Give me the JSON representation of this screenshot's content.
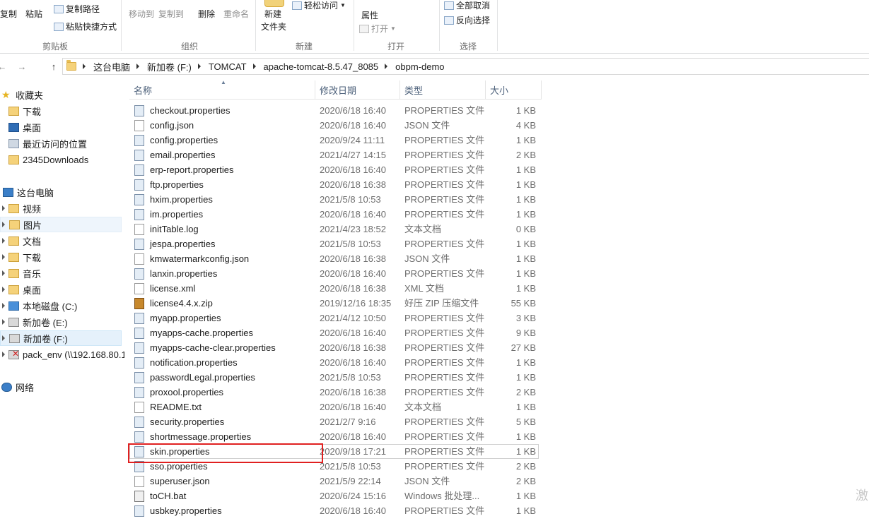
{
  "ribbon": {
    "copy": "复制",
    "paste": "粘贴",
    "copy_path": "复制路径",
    "paste_shortcut": "粘贴快捷方式",
    "clipboard": "剪贴板",
    "move_to": "移动到",
    "copy_to": "复制到",
    "delete": "删除",
    "rename": "重命名",
    "organize": "组织",
    "new_folder_1": "新建",
    "new_folder_2": "文件夹",
    "easy_access": "轻松访问",
    "new": "新建",
    "properties": "属性",
    "open": "打开",
    "open_group": "打开",
    "select_none": "全部取消",
    "invert_selection": "反向选择",
    "select": "选择"
  },
  "address": {
    "crumbs": [
      "这台电脑",
      "新加卷 (F:)",
      "TOMCAT",
      "apache-tomcat-8.5.47_8085",
      "obpm-demo"
    ]
  },
  "nav": {
    "favorites": "收藏夹",
    "downloads": "下载",
    "desktop": "桌面",
    "recent": "最近访问的位置",
    "d2345": "2345Downloads",
    "this_pc": "这台电脑",
    "videos": "视频",
    "pictures": "图片",
    "documents": "文档",
    "downloads2": "下载",
    "music": "音乐",
    "desktop2": "桌面",
    "drive_c": "本地磁盘 (C:)",
    "drive_e": "新加卷 (E:)",
    "drive_f": "新加卷 (F:)",
    "pack_env": "pack_env (\\\\192.168.80.1",
    "network": "网络"
  },
  "columns": {
    "name": "名称",
    "date": "修改日期",
    "type": "类型",
    "size": "大小"
  },
  "files": [
    {
      "name": "checkout.properties",
      "date": "2020/6/18 16:40",
      "type": "PROPERTIES 文件",
      "size": "1 KB",
      "icon": "properties-file-icon"
    },
    {
      "name": "config.json",
      "date": "2020/6/18 16:40",
      "type": "JSON 文件",
      "size": "4 KB",
      "icon": "document-icon"
    },
    {
      "name": "config.properties",
      "date": "2020/9/24 11:11",
      "type": "PROPERTIES 文件",
      "size": "1 KB",
      "icon": "properties-file-icon"
    },
    {
      "name": "email.properties",
      "date": "2021/4/27 14:15",
      "type": "PROPERTIES 文件",
      "size": "2 KB",
      "icon": "properties-file-icon"
    },
    {
      "name": "erp-report.properties",
      "date": "2020/6/18 16:40",
      "type": "PROPERTIES 文件",
      "size": "1 KB",
      "icon": "properties-file-icon"
    },
    {
      "name": "ftp.properties",
      "date": "2020/6/18 16:38",
      "type": "PROPERTIES 文件",
      "size": "1 KB",
      "icon": "properties-file-icon"
    },
    {
      "name": "hxim.properties",
      "date": "2021/5/8 10:53",
      "type": "PROPERTIES 文件",
      "size": "1 KB",
      "icon": "properties-file-icon"
    },
    {
      "name": "im.properties",
      "date": "2020/6/18 16:40",
      "type": "PROPERTIES 文件",
      "size": "1 KB",
      "icon": "properties-file-icon"
    },
    {
      "name": "initTable.log",
      "date": "2021/4/23 18:52",
      "type": "文本文档",
      "size": "0 KB",
      "icon": "document-icon"
    },
    {
      "name": "jespa.properties",
      "date": "2021/5/8 10:53",
      "type": "PROPERTIES 文件",
      "size": "1 KB",
      "icon": "properties-file-icon"
    },
    {
      "name": "kmwatermarkconfig.json",
      "date": "2020/6/18 16:38",
      "type": "JSON 文件",
      "size": "1 KB",
      "icon": "document-icon"
    },
    {
      "name": "lanxin.properties",
      "date": "2020/6/18 16:40",
      "type": "PROPERTIES 文件",
      "size": "1 KB",
      "icon": "properties-file-icon"
    },
    {
      "name": "license.xml",
      "date": "2020/6/18 16:38",
      "type": "XML 文档",
      "size": "1 KB",
      "icon": "document-icon"
    },
    {
      "name": "license4.4.x.zip",
      "date": "2019/12/16 18:35",
      "type": "好压 ZIP 压缩文件",
      "size": "55 KB",
      "icon": "zip-archive-icon"
    },
    {
      "name": "myapp.properties",
      "date": "2021/4/12 10:50",
      "type": "PROPERTIES 文件",
      "size": "3 KB",
      "icon": "properties-file-icon"
    },
    {
      "name": "myapps-cache.properties",
      "date": "2020/6/18 16:40",
      "type": "PROPERTIES 文件",
      "size": "9 KB",
      "icon": "properties-file-icon"
    },
    {
      "name": "myapps-cache-clear.properties",
      "date": "2020/6/18 16:38",
      "type": "PROPERTIES 文件",
      "size": "27 KB",
      "icon": "properties-file-icon"
    },
    {
      "name": "notification.properties",
      "date": "2020/6/18 16:40",
      "type": "PROPERTIES 文件",
      "size": "1 KB",
      "icon": "properties-file-icon"
    },
    {
      "name": "passwordLegal.properties",
      "date": "2021/5/8 10:53",
      "type": "PROPERTIES 文件",
      "size": "1 KB",
      "icon": "properties-file-icon"
    },
    {
      "name": "proxool.properties",
      "date": "2020/6/18 16:38",
      "type": "PROPERTIES 文件",
      "size": "2 KB",
      "icon": "properties-file-icon"
    },
    {
      "name": "README.txt",
      "date": "2020/6/18 16:40",
      "type": "文本文档",
      "size": "1 KB",
      "icon": "document-icon"
    },
    {
      "name": "security.properties",
      "date": "2021/2/7 9:16",
      "type": "PROPERTIES 文件",
      "size": "5 KB",
      "icon": "properties-file-icon"
    },
    {
      "name": "shortmessage.properties",
      "date": "2020/6/18 16:40",
      "type": "PROPERTIES 文件",
      "size": "1 KB",
      "icon": "properties-file-icon"
    },
    {
      "name": "skin.properties",
      "date": "2020/9/18 17:21",
      "type": "PROPERTIES 文件",
      "size": "1 KB",
      "icon": "properties-file-icon"
    },
    {
      "name": "sso.properties",
      "date": "2021/5/8 10:53",
      "type": "PROPERTIES 文件",
      "size": "2 KB",
      "icon": "properties-file-icon"
    },
    {
      "name": "superuser.json",
      "date": "2021/5/9 22:14",
      "type": "JSON 文件",
      "size": "2 KB",
      "icon": "document-icon"
    },
    {
      "name": "toCH.bat",
      "date": "2020/6/24 15:16",
      "type": "Windows 批处理...",
      "size": "1 KB",
      "icon": "batch-file-icon"
    },
    {
      "name": "usbkey.properties",
      "date": "2020/6/18 16:40",
      "type": "PROPERTIES 文件",
      "size": "1 KB",
      "icon": "properties-file-icon"
    }
  ],
  "watermark": "激"
}
